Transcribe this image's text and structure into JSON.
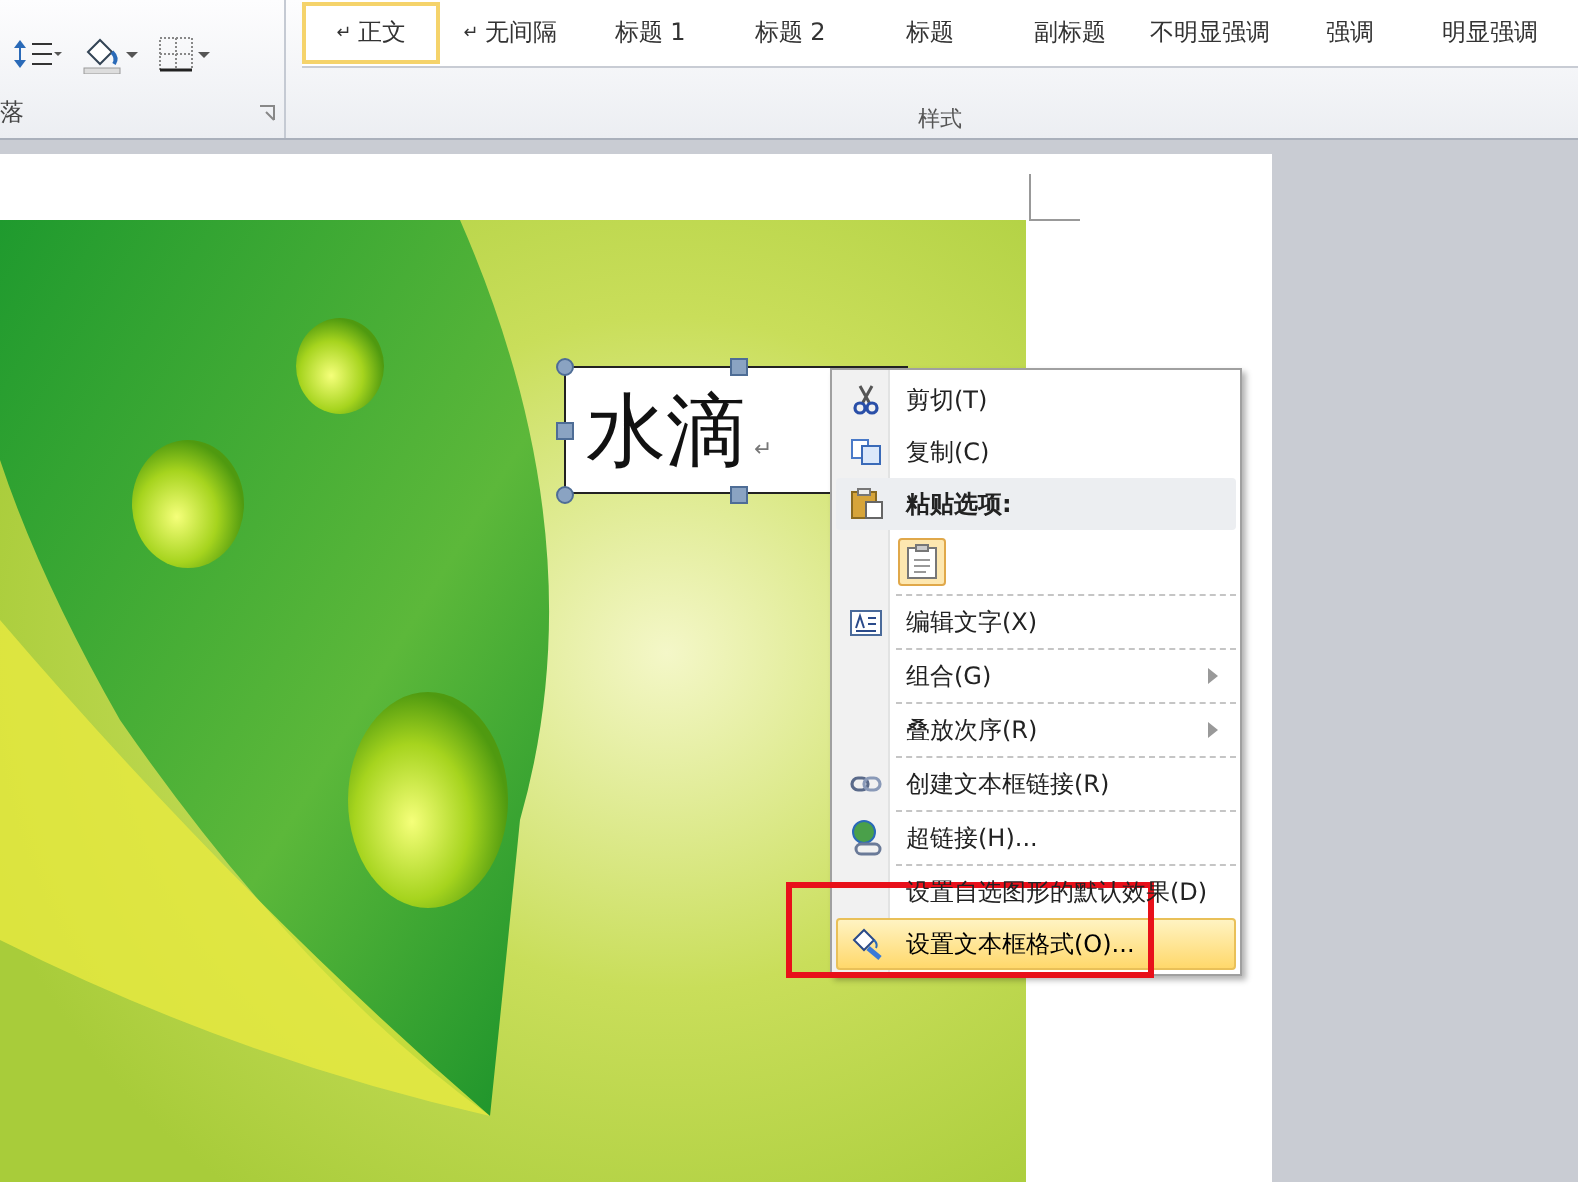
{
  "ribbon": {
    "paragraph_group": {
      "label": "落"
    },
    "styles_group": {
      "label": "样式",
      "styles": [
        {
          "mark": "↵",
          "label": "正文",
          "selected": true
        },
        {
          "mark": "↵",
          "label": "无间隔",
          "selected": false
        },
        {
          "label": "标题 1",
          "selected": false
        },
        {
          "label": "标题 2",
          "selected": false
        },
        {
          "label": "标题",
          "selected": false
        },
        {
          "label": "副标题",
          "selected": false
        },
        {
          "label": "不明显强调",
          "selected": false
        },
        {
          "label": "强调",
          "selected": false
        },
        {
          "label": "明显强调",
          "selected": false
        }
      ]
    }
  },
  "text_box": {
    "text": "水滴",
    "mark": "↵"
  },
  "context_menu": {
    "groups": [
      [
        {
          "kind": "item",
          "label": "剪切(T)",
          "submenu": false,
          "selected": false
        },
        {
          "kind": "item",
          "label": "复制(C)",
          "submenu": false,
          "selected": false
        },
        {
          "kind": "header",
          "label": "粘贴选项:"
        },
        {
          "kind": "paste"
        }
      ],
      [
        {
          "kind": "item",
          "label": "编辑文字(X)",
          "submenu": false,
          "selected": false
        }
      ],
      [
        {
          "kind": "item",
          "label": "组合(G)",
          "submenu": true,
          "selected": false
        }
      ],
      [
        {
          "kind": "item",
          "label": "叠放次序(R)",
          "submenu": true,
          "selected": false
        }
      ],
      [
        {
          "kind": "item",
          "label": "创建文本框链接(R)",
          "submenu": false,
          "selected": false
        }
      ],
      [
        {
          "kind": "item",
          "label": "超链接(H)...",
          "submenu": false,
          "selected": false
        }
      ],
      [
        {
          "kind": "item",
          "label": "设置自选图形的默认效果(D)",
          "submenu": false,
          "selected": false
        },
        {
          "kind": "item",
          "label": "设置文本框格式(O)...",
          "submenu": false,
          "selected": true
        }
      ]
    ]
  }
}
